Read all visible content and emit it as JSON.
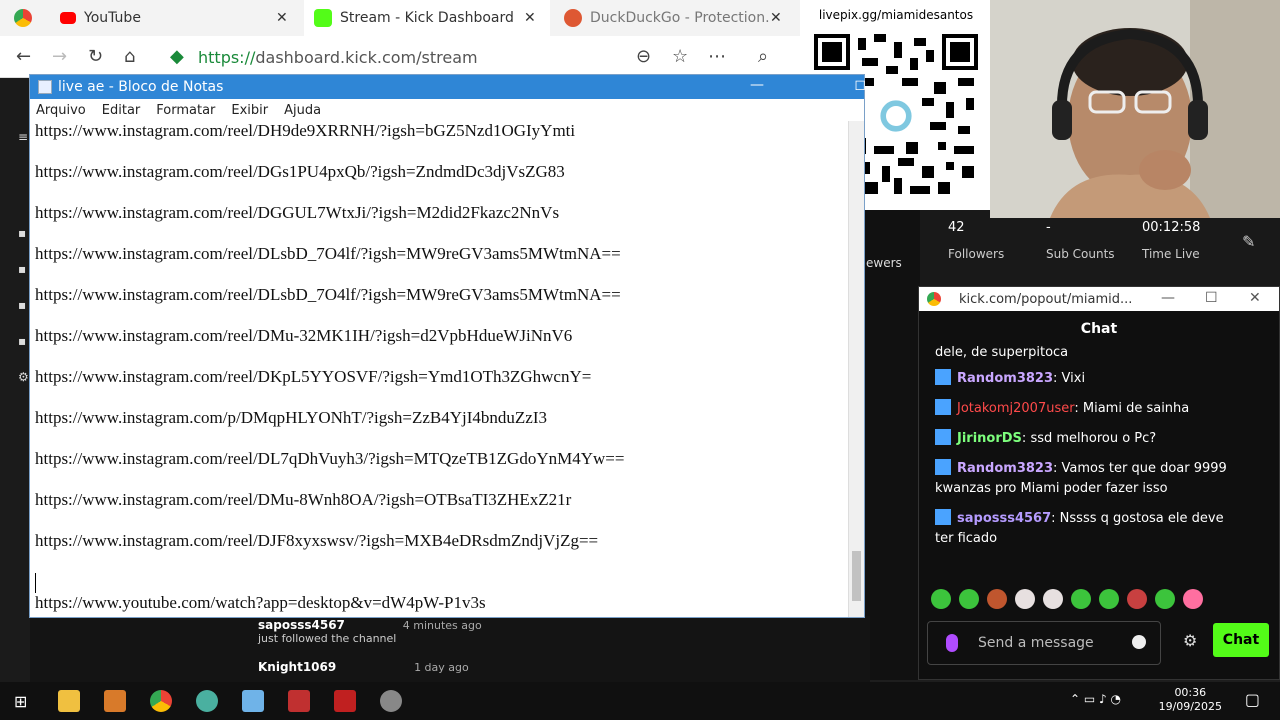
{
  "browser": {
    "tabs": [
      {
        "label": "YouTube"
      },
      {
        "label": "Stream - Kick Dashboard"
      },
      {
        "label": "DuckDuckGo - Protection."
      }
    ],
    "url_scheme": "https://",
    "url_rest": "dashboard.kick.com/stream"
  },
  "notepad": {
    "title": "live ae - Bloco de Notas",
    "menu": [
      "Arquivo",
      "Editar",
      "Formatar",
      "Exibir",
      "Ajuda"
    ],
    "lines": [
      "https://www.instagram.com/reel/DH9de9XRRNH/?igsh=bGZ5Nzd1OGIyYmti",
      "https://www.instagram.com/reel/DGs1PU4pxQb/?igsh=ZndmdDc3djVsZG83",
      "https://www.instagram.com/reel/DGGUL7WtxJi/?igsh=M2did2Fkazc2NnVs",
      "https://www.instagram.com/reel/DLsbD_7O4lf/?igsh=MW9reGV3ams5MWtmNA==",
      "https://www.instagram.com/reel/DLsbD_7O4lf/?igsh=MW9reGV3ams5MWtmNA==",
      "https://www.instagram.com/reel/DMu-32MK1IH/?igsh=d2VpbHdueWJiNnV6",
      "https://www.instagram.com/reel/DKpL5YYOSVF/?igsh=Ymd1OTh3ZGhwcnY=",
      "https://www.instagram.com/p/DMqpHLYONhT/?igsh=ZzB4YjI4bnduZzI3",
      "https://www.instagram.com/reel/DL7qDhVuyh3/?igsh=MTQzeTB1ZGdoYnM4Yw==",
      "https://www.instagram.com/reel/DMu-8Wnh8OA/?igsh=OTBsaTI3ZHExZ21r",
      "https://www.instagram.com/reel/DJF8xyxswsv/?igsh=MXB4eDRsdmZndjVjZg==",
      "",
      "https://www.youtube.com/watch?app=desktop&v=dW4pW-P1v3s"
    ]
  },
  "overlay": {
    "qr_label": "livepix.gg/miamidesantos"
  },
  "stats": {
    "followers_value": "42",
    "followers_label": "Followers",
    "subs_value": "-",
    "subs_label": "Sub Counts",
    "time_value": "00:12:58",
    "time_label": "Time Live",
    "viewers_label_partial": "ewers"
  },
  "chat": {
    "window_title": "kick.com/popout/miamid...",
    "header": "Chat",
    "intro": "dele, de superpitoca",
    "messages": [
      {
        "user": "Random3823",
        "text": "Vixi",
        "cls": "u1"
      },
      {
        "user": "Jotakomj2007user",
        "text": "Miami de sainha",
        "cls": "u2"
      },
      {
        "user": "JirinorDS",
        "text": "ssd melhorou o Pc?",
        "cls": "u3"
      },
      {
        "user": "Random3823",
        "text": "Vamos ter que doar 9999 kwanzas pro Miami poder fazer isso",
        "cls": "u1"
      },
      {
        "user": "saposss4567",
        "text": "Nssss q gostosa ele deve ter ficado",
        "cls": "u4"
      }
    ],
    "placeholder": "Send a message",
    "send_label": "Chat"
  },
  "followers_list": [
    {
      "name": "saposss4567",
      "action": "just followed the channel",
      "ago": "4 minutes ago"
    },
    {
      "name": "Knight1069",
      "action": "",
      "ago": "1 day ago"
    }
  ],
  "clock": {
    "time": "00:36",
    "date": "19/09/2025"
  }
}
